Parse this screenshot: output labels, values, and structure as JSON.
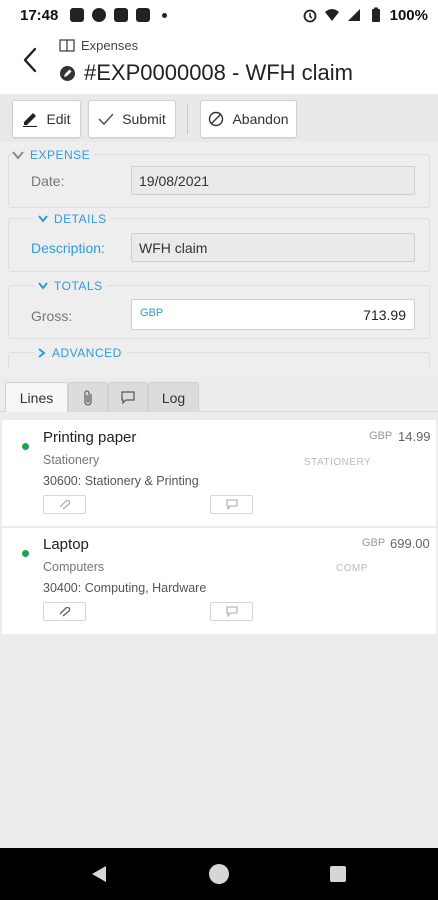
{
  "status_bar": {
    "time": "17:48",
    "battery": "100%",
    "icons": [
      "gmail-icon",
      "p-icon",
      "newspaper-icon",
      "calendar-icon",
      "alarm-icon",
      "wifi-icon",
      "signal-icon",
      "battery-icon"
    ]
  },
  "header": {
    "breadcrumb": "Expenses",
    "title": "#EXP0000008 - WFH claim"
  },
  "toolbar": {
    "edit_label": "Edit",
    "submit_label": "Submit",
    "abandon_label": "Abandon"
  },
  "form": {
    "expense_heading": "EXPENSE",
    "date_label": "Date:",
    "date_value": "19/08/2021",
    "details_heading": "DETAILS",
    "description_label": "Description:",
    "description_value": "WFH claim",
    "totals_heading": "TOTALS",
    "gross_label": "Gross:",
    "gross_currency": "GBP",
    "gross_value": "713.99",
    "advanced_heading": "ADVANCED"
  },
  "tabs": {
    "lines": "Lines",
    "log": "Log"
  },
  "lines": [
    {
      "name": "Printing paper",
      "category": "Stationery",
      "code": "30600: Stationery & Printing",
      "currency": "GBP",
      "amount": "14.99",
      "tag": "STATIONERY"
    },
    {
      "name": "Laptop",
      "category": "Computers",
      "code": "30400: Computing, Hardware",
      "currency": "GBP",
      "amount": "699.00",
      "tag": "COMP"
    }
  ],
  "colors": {
    "accent": "#2f9bd9",
    "status_dot": "#1aa64a"
  }
}
